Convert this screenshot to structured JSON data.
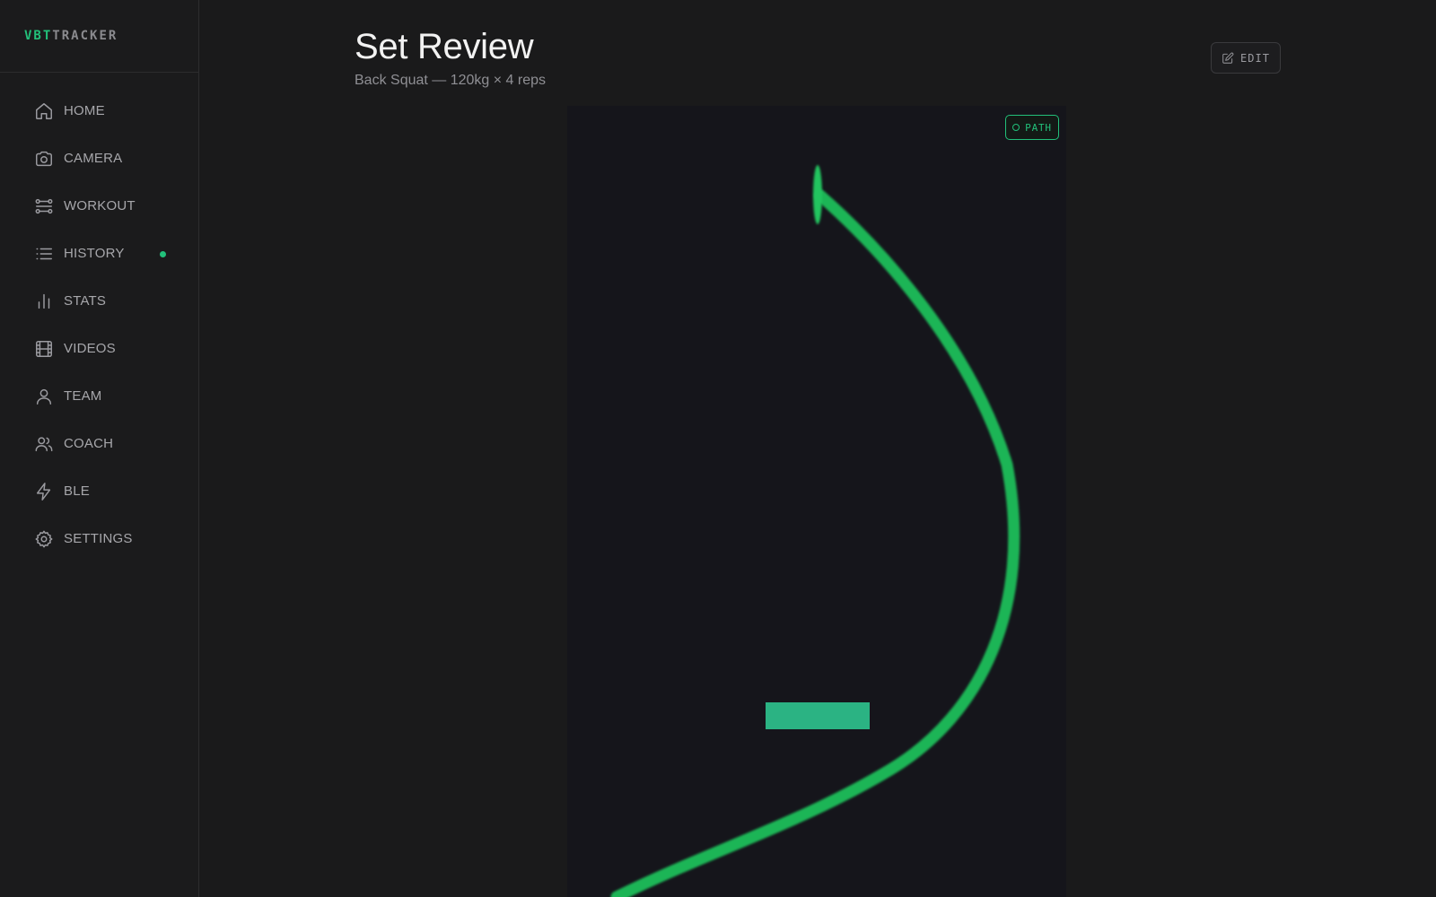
{
  "app": {
    "logo_accent": "VBT",
    "logo_rest": "TRACKER"
  },
  "sidebar": {
    "items": [
      {
        "label": "HOME",
        "icon": "home-icon"
      },
      {
        "label": "CAMERA",
        "icon": "camera-icon"
      },
      {
        "label": "WORKOUT",
        "icon": "workout-icon"
      },
      {
        "label": "HISTORY",
        "icon": "list-icon",
        "has_dot": true
      },
      {
        "label": "STATS",
        "icon": "bar-chart-icon"
      },
      {
        "label": "VIDEOS",
        "icon": "film-icon"
      },
      {
        "label": "TEAM",
        "icon": "user-icon"
      },
      {
        "label": "COACH",
        "icon": "users-icon"
      },
      {
        "label": "BLE",
        "icon": "bolt-icon"
      },
      {
        "label": "SETTINGS",
        "icon": "gear-icon"
      }
    ]
  },
  "header": {
    "title": "Set Review",
    "subtitle": "Back Squat — 120kg × 4 reps",
    "edit_label": "EDIT"
  },
  "viewer": {
    "badge_label": "PATH"
  },
  "colors": {
    "accent": "#22c07a",
    "path": "#1fb556",
    "marker": "#2bb383",
    "viewer_bg": "#15151b",
    "sidebar_bg": "#1b1b1c"
  }
}
